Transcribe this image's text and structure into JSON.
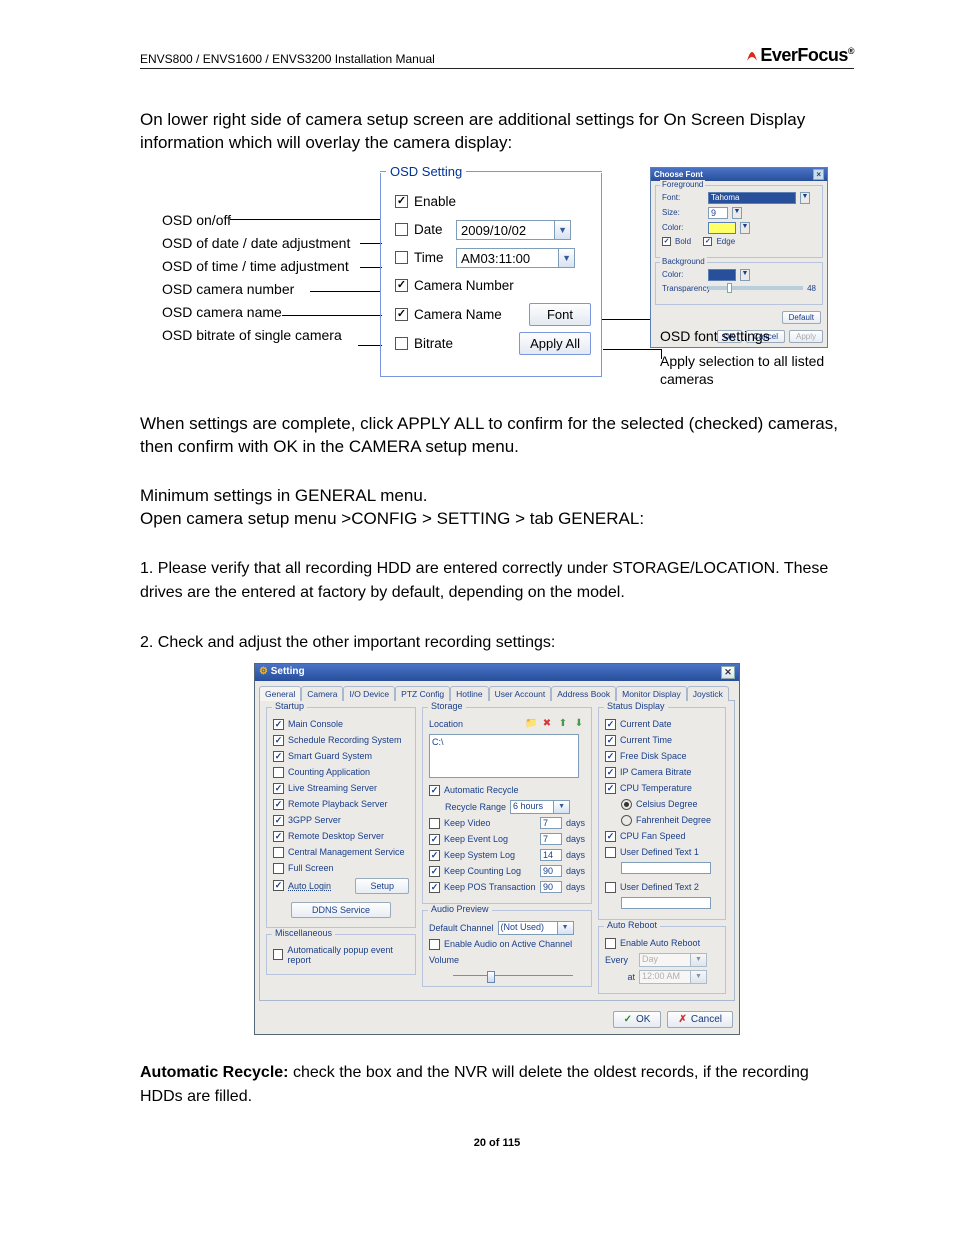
{
  "header": {
    "title": "ENVS800 / ENVS1600 / ENVS3200 Installation Manual",
    "brand": "EverFocus"
  },
  "intro": "On lower right side of camera setup screen are additional settings for On Screen Display information which will overlay the camera display:",
  "fig1": {
    "labels": {
      "onoff": "OSD on/off",
      "date": "OSD of date / date adjustment",
      "time": "OSD of time / time adjustment",
      "camnum": "OSD camera number",
      "camname": "OSD camera name",
      "bitrate": "OSD bitrate of single camera"
    },
    "panel": {
      "legend": "OSD Setting",
      "enable": "Enable",
      "date": "Date",
      "date_val": "2009/10/02",
      "time": "Time",
      "time_val": "AM03:11:00",
      "camnum": "Camera Number",
      "camname": "Camera Name",
      "bitrate": "Bitrate",
      "font_btn": "Font",
      "apply_btn": "Apply All"
    },
    "fontdlg": {
      "title": "Choose Font",
      "fg": "Foreground",
      "font": "Font:",
      "font_val": "Tahoma",
      "size": "Size:",
      "size_val": "9",
      "color": "Color:",
      "bold": "Bold",
      "edge": "Edge",
      "bg": "Background",
      "bcolor": "Color:",
      "trans": "Transparency",
      "trans_val": "48",
      "ok": "OK",
      "cancel": "Cancel",
      "apply": "Apply",
      "default": "Default"
    },
    "caption1": "OSD font settings",
    "caption2": "Apply selection to all listed cameras"
  },
  "body": {
    "p1": "When settings are complete, click APPLY ALL to confirm for the selected (checked) cameras, then confirm with OK in the CAMERA setup menu.",
    "p2": "Minimum settings in GENERAL menu.",
    "p3": "Open camera setup menu >CONFIG > SETTING > tab GENERAL:",
    "p4": "1. Please verify that all recording HDD are entered correctly under STORAGE/LOCATION. These drives are  the entered at factory by default, depending on the model.",
    "p5": "2. Check and adjust the other important recording settings:"
  },
  "dlg": {
    "title": "Setting",
    "tabs": [
      "General",
      "Camera",
      "I/O Device",
      "PTZ Config",
      "Hotline",
      "User Account",
      "Address Book",
      "Monitor Display",
      "Joystick"
    ],
    "startup": {
      "legend": "Startup",
      "items": [
        {
          "label": "Main Console",
          "on": true
        },
        {
          "label": "Schedule Recording System",
          "on": true
        },
        {
          "label": "Smart Guard System",
          "on": true
        },
        {
          "label": "Counting Application",
          "on": false
        },
        {
          "label": "Live Streaming Server",
          "on": true
        },
        {
          "label": "Remote Playback Server",
          "on": true
        },
        {
          "label": "3GPP Server",
          "on": true
        },
        {
          "label": "Remote Desktop Server",
          "on": true
        },
        {
          "label": "Central Management Service",
          "on": false
        },
        {
          "label": "Full Screen",
          "on": false
        }
      ],
      "autologin": "Auto Login",
      "setup_btn": "Setup",
      "ddns_btn": "DDNS Service"
    },
    "misc": {
      "legend": "Miscellaneous",
      "item": "Automatically popup event report"
    },
    "storage": {
      "legend": "Storage",
      "location": "Location",
      "loc_val": "C:\\",
      "auto_recycle": "Automatic Recycle",
      "recycle_range": "Recycle Range",
      "recycle_val": "6 hours",
      "rows": [
        {
          "label": "Keep Video",
          "val": "7",
          "unit": "days",
          "on": false
        },
        {
          "label": "Keep Event Log",
          "val": "7",
          "unit": "days",
          "on": true
        },
        {
          "label": "Keep System Log",
          "val": "14",
          "unit": "days",
          "on": true
        },
        {
          "label": "Keep Counting Log",
          "val": "90",
          "unit": "days",
          "on": true
        },
        {
          "label": "Keep POS Transaction",
          "val": "90",
          "unit": "days",
          "on": true
        }
      ]
    },
    "audio": {
      "legend": "Audio Preview",
      "defchan": "Default Channel",
      "defchan_val": "(Not Used)",
      "enable_audio": "Enable Audio on Active Channel",
      "volume": "Volume"
    },
    "status": {
      "legend": "Status Display",
      "items": [
        {
          "label": "Current Date",
          "on": true,
          "type": "cb"
        },
        {
          "label": "Current Time",
          "on": true,
          "type": "cb"
        },
        {
          "label": "Free Disk Space",
          "on": true,
          "type": "cb"
        },
        {
          "label": "IP Camera Bitrate",
          "on": true,
          "type": "cb"
        },
        {
          "label": "CPU Temperature",
          "on": true,
          "type": "cb"
        },
        {
          "label": "Celsius Degree",
          "on": true,
          "type": "rb"
        },
        {
          "label": "Fahrenheit Degree",
          "on": false,
          "type": "rb"
        },
        {
          "label": "CPU Fan Speed",
          "on": true,
          "type": "cb"
        }
      ],
      "ud1": "User Defined Text 1",
      "ud2": "User Defined Text 2"
    },
    "reboot": {
      "legend": "Auto Reboot",
      "enable": "Enable Auto Reboot",
      "every": "Every",
      "every_val": "Day",
      "at": "at",
      "at_val": "12:00 AM"
    },
    "ok": "OK",
    "cancel": "Cancel"
  },
  "auto_recycle": {
    "label": "Automatic Recycle:",
    "text": "  check the box and the NVR will delete the oldest records, if the recording HDDs are filled."
  },
  "footer": "20 of 115"
}
